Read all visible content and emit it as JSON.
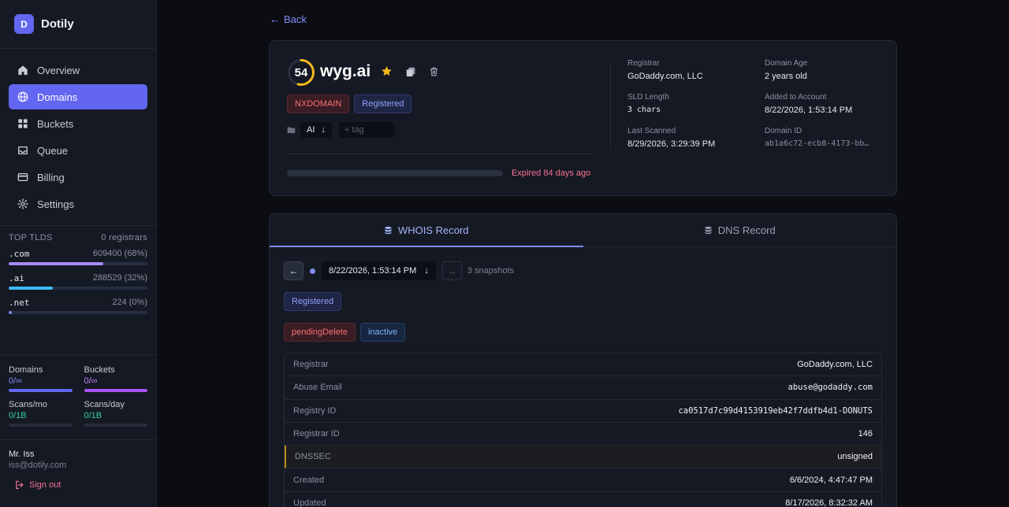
{
  "brand": {
    "logo_letter": "D",
    "name": "Dotily"
  },
  "nav": [
    {
      "label": "Overview",
      "icon": "home-icon",
      "active": false
    },
    {
      "label": "Domains",
      "icon": "globe-icon",
      "active": true
    },
    {
      "label": "Buckets",
      "icon": "grid-icon",
      "active": false
    },
    {
      "label": "Queue",
      "icon": "inbox-icon",
      "active": false
    },
    {
      "label": "Billing",
      "icon": "credit-card-icon",
      "active": false
    },
    {
      "label": "Settings",
      "icon": "gear-icon",
      "active": false
    }
  ],
  "top_tlds": {
    "title": "TOP TLDS",
    "registrars": "0 registrars",
    "items": [
      {
        "name": ".com",
        "count": "609400 (68%)",
        "share": 0.68,
        "color": "#a78bfa"
      },
      {
        "name": ".ai",
        "count": "288529 (32%)",
        "share": 0.32,
        "color": "#38bdf8"
      },
      {
        "name": ".net",
        "count": "224 (0%)",
        "share": 0.0,
        "color": "#818cf8"
      }
    ]
  },
  "usage": [
    {
      "label": "Domains",
      "value": "0/∞",
      "value_color": "#818cf8",
      "fill": 1.0,
      "bar_color": "#6366f1"
    },
    {
      "label": "Buckets",
      "value": "0/∞",
      "value_color": "#c084fc",
      "fill": 1.0,
      "bar_color": "#a855f7"
    },
    {
      "label": "Scans/mo",
      "value": "0/1B",
      "value_color": "#34d399",
      "fill": 0.0,
      "bar_color": "#34d399"
    },
    {
      "label": "Scans/day",
      "value": "0/1B",
      "value_color": "#34d399",
      "fill": 0.0,
      "bar_color": "#34d399"
    }
  ],
  "user": {
    "name": "Mr. Iss",
    "email": "iss@dotily.com",
    "signout": "Sign out"
  },
  "back_label": "Back",
  "domain": {
    "score": "54",
    "score_fraction": 0.54,
    "name": "wyg.ai",
    "badges": [
      {
        "label": "NXDOMAIN",
        "style": "red"
      },
      {
        "label": "Registered",
        "style": "blue"
      }
    ],
    "tag": "AI",
    "tag_placeholder": "+ tag",
    "expired": "Expired 84 days ago",
    "info": {
      "registrar_label": "Registrar",
      "registrar": "GoDaddy.com, LLC",
      "age_label": "Domain Age",
      "age": "2 years old",
      "sld_label": "SLD Length",
      "sld": "3 chars",
      "added_label": "Added to Account",
      "added": "8/22/2026, 1:53:14 PM",
      "scanned_label": "Last Scanned",
      "scanned": "8/29/2026, 3:29:39 PM",
      "id_label": "Domain ID",
      "id": "ab1a6c72-ecb8-4173-bb…"
    }
  },
  "tabs": [
    {
      "label": "WHOIS Record",
      "active": true
    },
    {
      "label": "DNS Record",
      "active": false
    }
  ],
  "snapshot": {
    "date": "8/22/2026, 1:53:14 PM",
    "count": "3 snapshots"
  },
  "whois_status": "Registered",
  "whois_flags": [
    {
      "label": "pendingDelete",
      "style": "red"
    },
    {
      "label": "inactive",
      "style": "navy"
    }
  ],
  "whois_rows": [
    {
      "key": "Registrar",
      "value": "GoDaddy.com, LLC",
      "mono": false
    },
    {
      "key": "Abuse Email",
      "value": "abuse@godaddy.com",
      "mono": true
    },
    {
      "key": "Registry ID",
      "value": "ca0517d7c99d4153919eb42f7ddfb4d1-DONUTS",
      "mono": true
    },
    {
      "key": "Registrar ID",
      "value": "146",
      "mono": false
    },
    {
      "key": "DNSSEC",
      "value": "unsigned",
      "mono": false,
      "warn": true
    },
    {
      "key": "Created",
      "value": "6/6/2024, 4:47:47 PM",
      "mono": false
    },
    {
      "key": "Updated",
      "value": "8/17/2026, 8:32:32 AM",
      "mono": false
    }
  ]
}
